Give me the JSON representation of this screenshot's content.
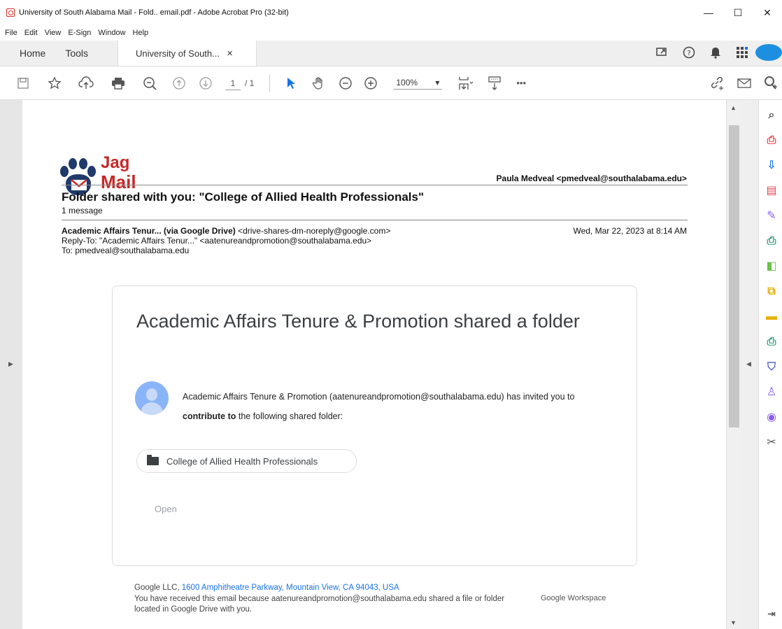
{
  "window": {
    "title": "University of South Alabama Mail - Fold.. email.pdf - Adobe Acrobat Pro (32-bit)",
    "minimize": "—",
    "maximize": "☐",
    "close": "✕"
  },
  "menu": [
    "File",
    "Edit",
    "View",
    "E-Sign",
    "Window",
    "Help"
  ],
  "tabs": {
    "home": "Home",
    "tools": "Tools",
    "document": "University of South...",
    "close": "✕"
  },
  "toolbar": {
    "page_current": "1",
    "page_total": "/ 1",
    "zoom": "100%",
    "zoom_arrow": "▾",
    "more": "•••"
  },
  "email": {
    "logo_line1": "Jag",
    "logo_line2": "Mail",
    "account": "Paula Medveal <pmedveal@southalabama.edu>",
    "subject": "Folder shared with you: \"College of Allied Health Professionals\"",
    "message_count": "1 message",
    "from_name": "Academic Affairs Tenur... (via Google Drive)",
    "from_address": " <drive-shares-dm-noreply@google.com>",
    "date": "Wed, Mar 22, 2023 at 8:14 AM",
    "reply_to": "Reply-To: \"Academic Affairs Tenur...\" <aatenureandpromotion@southalabama.edu>",
    "to": "To: pmedveal@southalabama.edu"
  },
  "card": {
    "title": "Academic Affairs Tenure & Promotion shared a folder",
    "body_prefix": "Academic Affairs Tenure & Promotion (aatenureandpromotion@southalabama.edu) has invited you to ",
    "body_bold": "contribute to",
    "body_suffix": " the following shared folder:",
    "folder_name": "College of Allied Health Professionals",
    "open_label": "Open"
  },
  "footer": {
    "company": "Google LLC, ",
    "address": "1600 Amphitheatre Parkway, Mountain View, CA 94043, USA",
    "notice": "You have received this email because aatenureandpromotion@southalabama.edu shared a file or folder located in Google Drive with you.",
    "workspace": "Google Workspace"
  },
  "colors": {
    "accent_red": "#c62828",
    "link_blue": "#1a73e8",
    "acrobat_blue": "#1473e6"
  }
}
